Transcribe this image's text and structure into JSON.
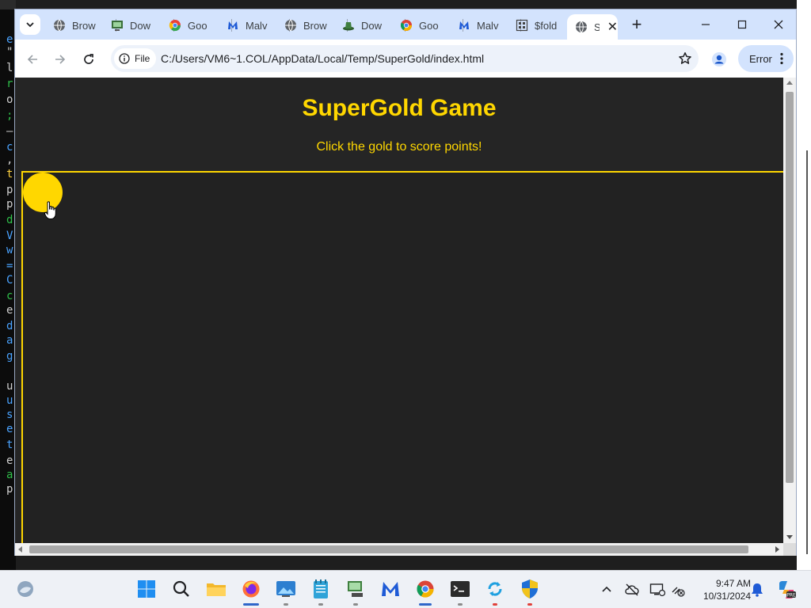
{
  "terminal": {
    "lines": [
      {
        "text": "e",
        "color": "#4aa3ff"
      },
      {
        "text": "\"",
        "color": "#cfcfcf"
      },
      {
        "text": "l",
        "color": "#cfcfcf"
      },
      {
        "text": "r",
        "color": "#2fbf4a"
      },
      {
        "text": "o",
        "color": "#cfcfcf"
      },
      {
        "text": ";",
        "color": "#2fbf4a"
      },
      {
        "text": "—",
        "color": "#cfcfcf"
      },
      {
        "text": "c",
        "color": "#4aa3ff"
      },
      {
        "text": ",",
        "color": "#cfcfcf"
      },
      {
        "text": "t",
        "color": "#ffd23f"
      },
      {
        "text": "p",
        "color": "#cfcfcf"
      },
      {
        "text": "p",
        "color": "#cfcfcf"
      },
      {
        "text": "d",
        "color": "#2fbf4a"
      },
      {
        "text": "V",
        "color": "#4aa3ff"
      },
      {
        "text": "w",
        "color": "#4aa3ff"
      },
      {
        "text": "=",
        "color": "#4aa3ff"
      },
      {
        "text": "C",
        "color": "#4aa3ff"
      },
      {
        "text": "c",
        "color": "#2fbf4a"
      },
      {
        "text": "e",
        "color": "#cfcfcf"
      },
      {
        "text": "d",
        "color": "#4aa3ff"
      },
      {
        "text": "a",
        "color": "#4aa3ff"
      },
      {
        "text": "g",
        "color": "#4aa3ff"
      },
      {
        "text": "",
        "color": "#cfcfcf"
      },
      {
        "text": "u",
        "color": "#cfcfcf"
      },
      {
        "text": "u",
        "color": "#4aa3ff"
      },
      {
        "text": "s",
        "color": "#4aa3ff"
      },
      {
        "text": "e",
        "color": "#4aa3ff"
      },
      {
        "text": "t",
        "color": "#4aa3ff"
      },
      {
        "text": "e",
        "color": "#cfcfcf"
      },
      {
        "text": "a",
        "color": "#2fbf4a"
      },
      {
        "text": "p",
        "color": "#cfcfcf"
      }
    ]
  },
  "browser": {
    "tabs": [
      {
        "title": "Brow",
        "icon": "globe-icon"
      },
      {
        "title": "Dow",
        "icon": "monitor-icon"
      },
      {
        "title": "Goo",
        "icon": "google-icon"
      },
      {
        "title": "Malv",
        "icon": "malwarebytes-icon"
      },
      {
        "title": "Brow",
        "icon": "globe-icon"
      },
      {
        "title": "Dow",
        "icon": "hat-icon"
      },
      {
        "title": "Goo",
        "icon": "chrome-icon"
      },
      {
        "title": "Malv",
        "icon": "malwarebytes-icon"
      },
      {
        "title": "$fold",
        "icon": "folder-app-icon"
      }
    ],
    "active_tab": {
      "title": "S",
      "icon": "globe-icon"
    },
    "new_tab_label": "+",
    "site_chip_label": "File",
    "url": "C:/Users/VM6~1.COL/AppData/Local/Temp/SuperGold/index.html",
    "error_label": "Error"
  },
  "page": {
    "title": "SuperGold Game",
    "subtitle": "Click the gold to score points!",
    "accent_color": "#ffd700",
    "background_color": "#252525"
  },
  "taskbar": {
    "apps": [
      "start-icon",
      "search-icon",
      "file-explorer-icon",
      "firefox-icon",
      "photos-icon",
      "notepad-icon",
      "network-icon",
      "malwarebytes-icon",
      "chrome-icon",
      "terminal-icon",
      "sync-icon",
      "security-shield-icon"
    ],
    "time": "9:47 AM",
    "date": "10/31/2024"
  }
}
